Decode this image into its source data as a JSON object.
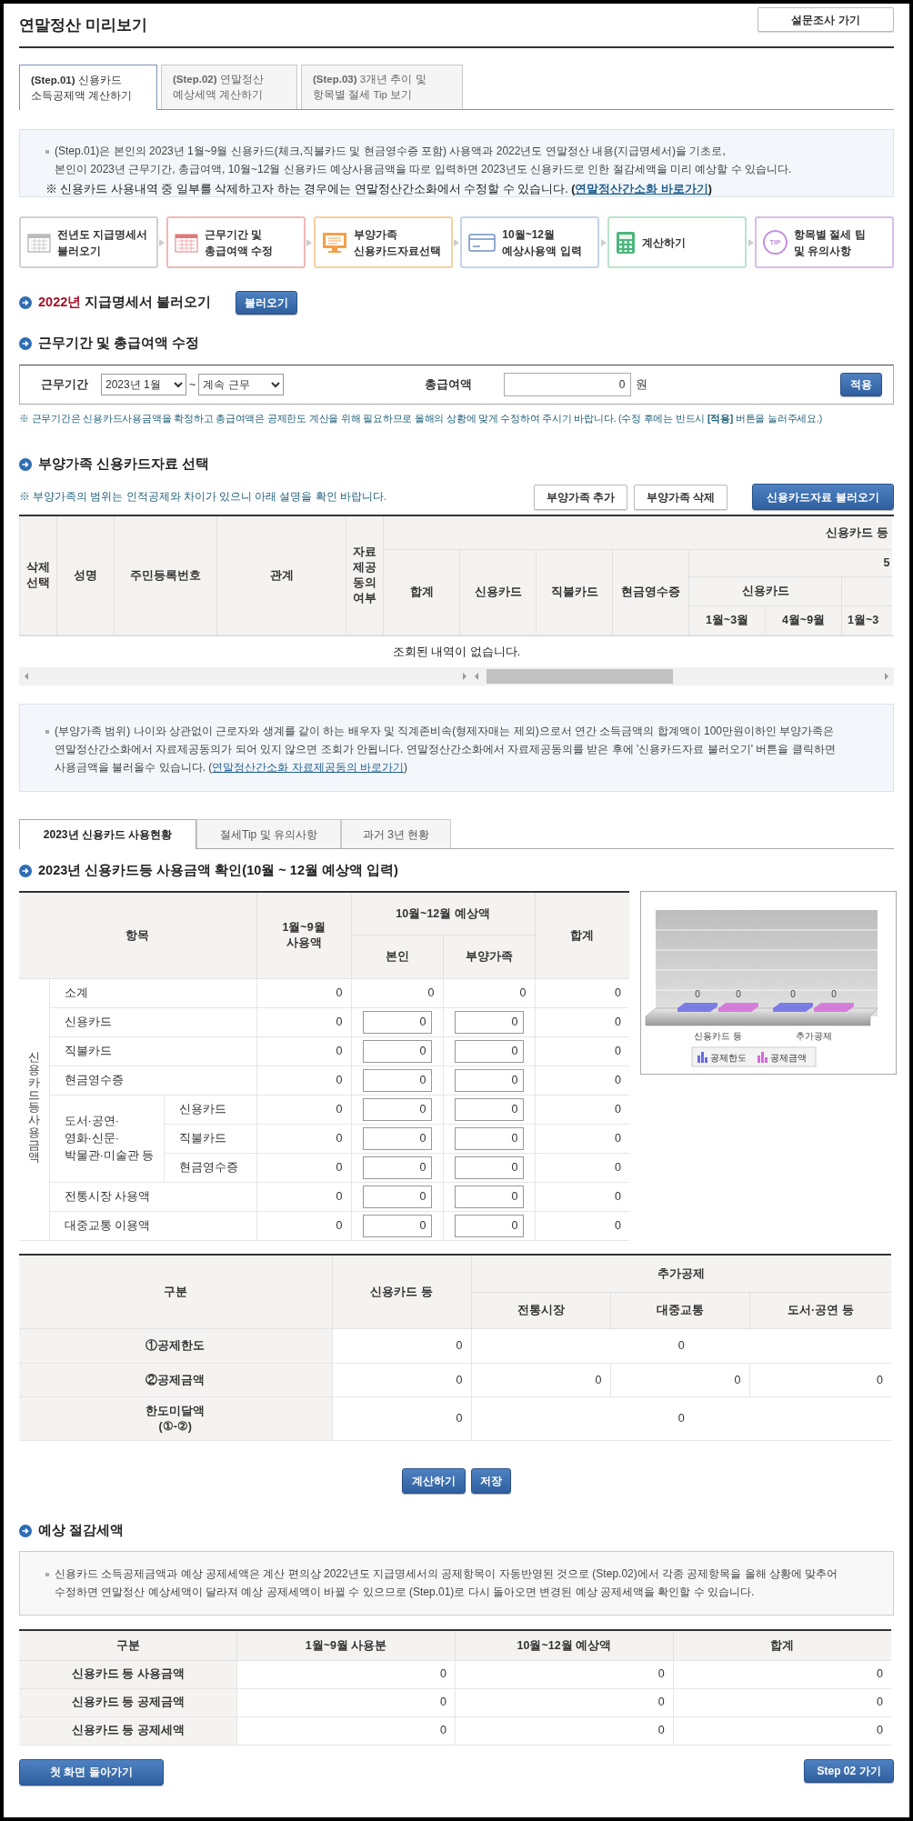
{
  "page": {
    "title": "연말정산 미리보기",
    "survey_button": "설문조사 가기"
  },
  "step_tabs": [
    {
      "lines": [
        "**(Step.01)** 신용카드",
        "소득공제액 계산하기"
      ],
      "selected": true
    },
    {
      "lines": [
        "**(Step.02)** 연말정산",
        "예상세액 계산하기"
      ],
      "selected": false
    },
    {
      "lines": [
        "**(Step.03)** 3개년 추이 및",
        "항목별 절세 Tip 보기"
      ],
      "selected": false
    }
  ],
  "intro": {
    "lines": [
      "(Step.01)은 본인의 2023년 1월~9월 신용카드(체크,직불카드 및 현금영수증 포함) 사용액과 2022년도 연말정산 내용(지급명세서)을 기초로,",
      "본인이 2023년 근무기간, 총급여액, 10월~12월 신용카드 예상사용금액을 따로 입력하면 2023년도 신용카드로 인한 절감세액을 미리 예상할 수 있습니다."
    ],
    "note": "※ 신용카드 사용내역 중 일부를 삭제하고자 하는 경우에는 연말정산간소화에서 수정할 수 있습니다. **(**",
    "link": "연말정산간소화 바로가기",
    "note_end": ")"
  },
  "steps": [
    {
      "kind": "calendar",
      "lines": [
        "전년도 지급명세서",
        "불러오기"
      ],
      "color": "#d2d2d2"
    },
    {
      "kind": "schedule",
      "lines": [
        "근무기간 및",
        "총급여액 수정"
      ],
      "color": "#f0b9b9"
    },
    {
      "kind": "monitor",
      "lines": [
        "부양가족",
        "신용카드자료선택"
      ],
      "color": "#f5d0a3"
    },
    {
      "kind": "card",
      "lines": [
        "10월~12월",
        "예상사용액 입력"
      ],
      "color": "#c6d3ea"
    },
    {
      "kind": "calculator",
      "lines": [
        "계산하기"
      ],
      "color": "#b9e5cd"
    },
    {
      "kind": "tip",
      "badge": "TIP",
      "lines": [
        "항목별 절세 팁",
        "및 유의사항"
      ],
      "color": "#d8bdea"
    }
  ],
  "load_section": {
    "year": "2022년",
    "title": "지급명세서 불러오기",
    "button": "불러오기"
  },
  "work_section": {
    "title": "근무기간 및 총급여액 수정",
    "period_label": "근무기간",
    "start": "2023년 1월",
    "separator": "~",
    "end": "계속 근무",
    "salary_label": "총급여액",
    "salary": "0",
    "unit": "원",
    "apply_button": "적용",
    "note": "※ 근무기간은 신용카드사용금액을 확정하고 총급여액은 공제한도 계산을 위해 필요하므로 올해의 상황에 맞게 수정하여 주시기 바랍니다. (수정 후에는 반드시 **[적용]** 버튼을 눌러주세요.)"
  },
  "dependents": {
    "title": "부양가족 신용카드자료 선택",
    "note": "※ 부양가족의 범위는 인적공제와 차이가 있으니 아래 설명을 확인 바랍니다.",
    "buttons": [
      "부양가족 추가",
      "부양가족 삭제"
    ],
    "load_button": "신용카드자료 불러오기",
    "fixed_columns": [
      "삭제선택",
      "성명",
      "주민등록번호",
      "관계",
      "자료제공동의여부"
    ],
    "group": "신용카드 등",
    "amount_columns": [
      "합계",
      "신용카드",
      "직불카드",
      "현금영수증"
    ],
    "column_group_cut": "5",
    "sub_group": "신용카드",
    "months": [
      "1월~3월",
      "4월~9월",
      "1월~3"
    ],
    "empty": "조회된 내역이 없습니다.",
    "info_lines": [
      "(부양가족 범위) 나이와 상관없이 근로자와 생계를 같이 하는 배우자 및 직계존비속(형제자매는 제외)으로서 연간 소득금액의 합계액이 100만원이하인 부양가족은",
      "연말정산간소화에서 자료제공동의가 되어 있지 않으면 조회가 안됩니다. 연말정산간소화에서 자료제공동의를 받은 후에 '신용카드자료 불러오기' 버튼을 클릭하면",
      "사용금액을 불러올수 있습니다. ("
    ],
    "info_link": "연말정산간소화 자료제공동의 바로가기",
    "info_end": ")"
  },
  "usage_tabs": [
    {
      "label": "2023년 신용카드 사용현황",
      "selected": true
    },
    {
      "label": "절세Tip 및 유의사항",
      "selected": false
    },
    {
      "label": "과거 3년 현황",
      "selected": false
    }
  ],
  "usage": {
    "title": "2023년 신용카드등 사용금액 확인(10월 ~ 12월 예상액 입력)",
    "headers": {
      "item": "항목",
      "jan_sep": "1월~9월 사용액",
      "forecast": "10월~12월 예상액",
      "self": "본인",
      "family": "부양가족",
      "total": "합계"
    },
    "group_label": "신용카드등 사용금액",
    "rows": [
      {
        "kind": "sum",
        "label": "소계",
        "jan_sep": "0",
        "self": "0",
        "family": "0",
        "total": "0"
      },
      {
        "kind": "input",
        "label": "신용카드",
        "jan_sep": "0",
        "self": "0",
        "family": "0",
        "total": "0"
      },
      {
        "kind": "input",
        "label": "직불카드",
        "jan_sep": "0",
        "self": "0",
        "family": "0",
        "total": "0"
      },
      {
        "kind": "input",
        "label": "현금영수증",
        "jan_sep": "0",
        "self": "0",
        "family": "0",
        "total": "0"
      },
      {
        "kind": "group",
        "lines": [
          "도서·공연·",
          "영화·신문·",
          "박물관·미술관 등"
        ],
        "children": [
          {
            "kind": "input",
            "label": "신용카드",
            "jan_sep": "0",
            "self": "0",
            "family": "0",
            "total": "0"
          },
          {
            "kind": "input",
            "label": "직불카드",
            "jan_sep": "0",
            "self": "0",
            "family": "0",
            "total": "0"
          },
          {
            "kind": "input",
            "label": "현금영수증",
            "jan_sep": "0",
            "self": "0",
            "family": "0",
            "total": "0"
          }
        ]
      },
      {
        "kind": "input",
        "label": "전통시장 사용액",
        "jan_sep": "0",
        "self": "0",
        "family": "0",
        "total": "0"
      },
      {
        "kind": "input",
        "label": "대중교통 이용액",
        "jan_sep": "0",
        "self": "0",
        "family": "0",
        "total": "0"
      }
    ],
    "chart": {
      "categories": [
        "신용카드 등",
        "추가공제"
      ],
      "series": [
        {
          "name": "공제한도",
          "color": "#6b6be6",
          "labels": [
            "0",
            "0"
          ]
        },
        {
          "name": "공제금액",
          "color": "#d56bd8",
          "labels": [
            "0",
            "0"
          ]
        }
      ]
    }
  },
  "summary": {
    "headers": {
      "item": "구분",
      "card": "신용카드 등",
      "extra": "추가공제",
      "market": "전통시장",
      "transit": "대중교통",
      "culture": "도서·공연 등"
    },
    "rows": [
      {
        "kind": "merged",
        "lines": [
          "①공제한도"
        ],
        "card": "0",
        "extra": "0"
      },
      {
        "kind": "split",
        "lines": [
          "②공제금액"
        ],
        "card": "0",
        "values": [
          "0",
          "0",
          "0"
        ]
      },
      {
        "kind": "merged",
        "lines": [
          "한도미달액",
          "(①-②)"
        ],
        "card": "0",
        "extra": "0"
      }
    ]
  },
  "actions": [
    "계산하기",
    "저장"
  ],
  "savings": {
    "title": "예상 절감세액",
    "info_lines": [
      "신용카드 소득공제금액과 예상 공제세액은 계산 편의상 2022년도 지급명세서의 공제항목이 자동반영된 것으로 (Step.02)에서 각종 공제항목을 올해 상황에 맞추어",
      "수정하면 연말정산 예상세액이 달라져 예상 공제세액이 바뀔 수 있으므로 (Step.01)로 다시 돌아오면 변경된 예상 공제세액을 확인할 수 있습니다."
    ],
    "columns": [
      "구분",
      "1월~9월 사용분",
      "10월~12월 예상액",
      "합계"
    ],
    "rows": [
      {
        "label": "신용카드 등 사용금액",
        "values": [
          "0",
          "0",
          "0"
        ]
      },
      {
        "label": "신용카드 등 공제금액",
        "values": [
          "0",
          "0",
          "0"
        ]
      },
      {
        "label": "신용카드 등 공제세액",
        "values": [
          "0",
          "0",
          "0"
        ]
      }
    ]
  },
  "footer": {
    "back_button": "첫 화면 돌아가기",
    "next_button": "Step 02 가기"
  }
}
